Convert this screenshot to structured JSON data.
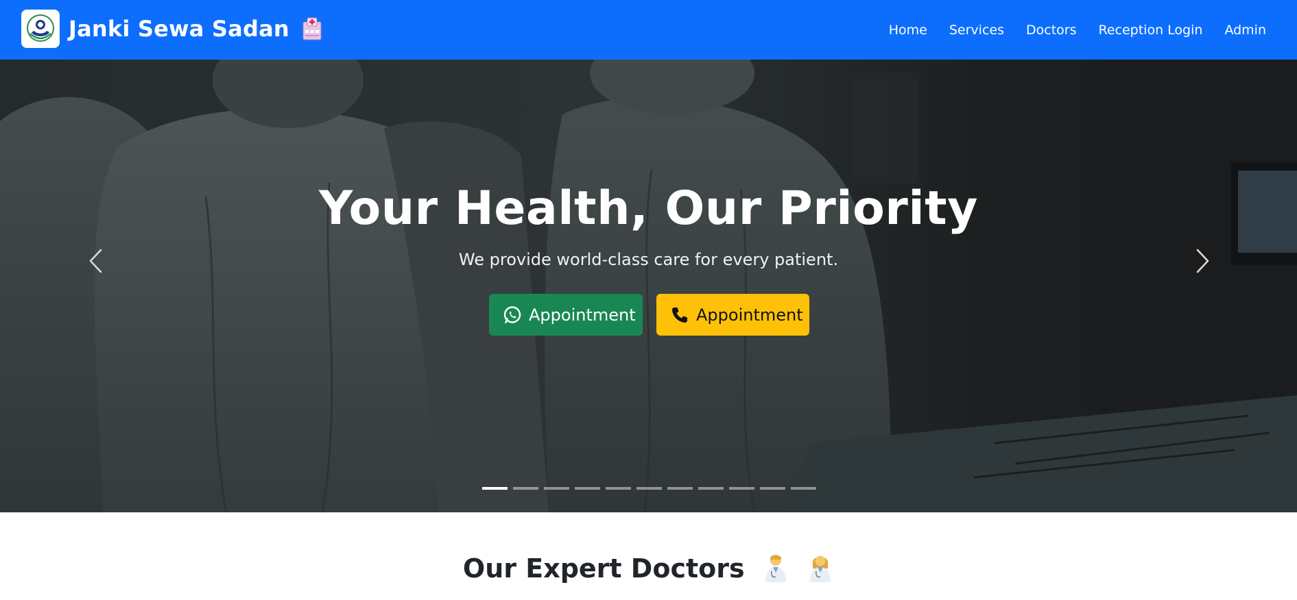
{
  "navbar": {
    "brand_title": "Janki Sewa Sadan",
    "logo_icon": "hospital-hands-logo-icon",
    "brand_emoji_icon": "hospital-building-icon",
    "links": [
      {
        "label": "Home"
      },
      {
        "label": "Services"
      },
      {
        "label": "Doctors"
      },
      {
        "label": "Reception Login"
      },
      {
        "label": "Admin"
      }
    ],
    "bg_color": "#0d6efd"
  },
  "hero": {
    "title": "Your Health, Our Priority",
    "subtitle": "We provide world-class care for every patient.",
    "buttons": [
      {
        "label": "Appointment",
        "icon": "whatsapp-icon",
        "color": "#198754"
      },
      {
        "label": "Appointment",
        "icon": "phone-icon",
        "color": "#ffc107"
      }
    ],
    "slide_count": 11,
    "active_slide": 1
  },
  "doctors_section": {
    "heading": "Our Expert Doctors",
    "heading_icons": [
      "male-doctor-icon",
      "female-doctor-icon"
    ]
  }
}
